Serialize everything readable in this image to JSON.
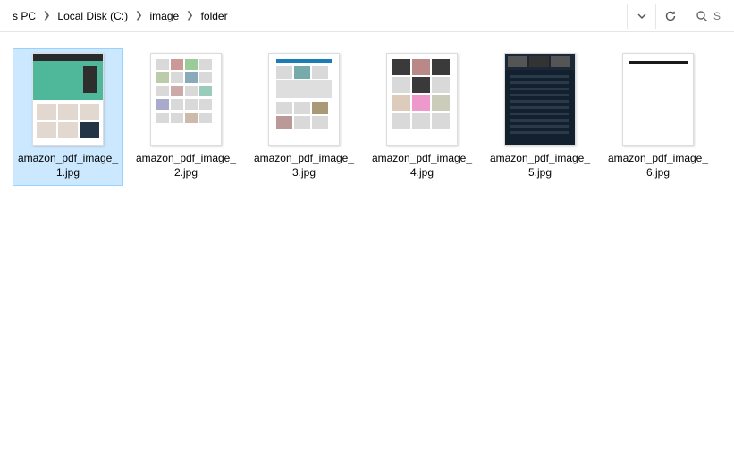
{
  "breadcrumb": {
    "items": [
      {
        "label": "s PC"
      },
      {
        "label": "Local Disk (C:)"
      },
      {
        "label": "image"
      },
      {
        "label": "folder"
      }
    ]
  },
  "toolbar": {
    "dropdown_name": "recent-locations-dropdown",
    "refresh_name": "refresh-button"
  },
  "search": {
    "placeholder": "S"
  },
  "files": [
    {
      "name": "amazon_pdf_image_1.jpg",
      "thumb": "t1",
      "selected": true
    },
    {
      "name": "amazon_pdf_image_2.jpg",
      "thumb": "t2",
      "selected": false
    },
    {
      "name": "amazon_pdf_image_3.jpg",
      "thumb": "t3",
      "selected": false
    },
    {
      "name": "amazon_pdf_image_4.jpg",
      "thumb": "t4",
      "selected": false
    },
    {
      "name": "amazon_pdf_image_5.jpg",
      "thumb": "t5",
      "selected": false
    },
    {
      "name": "amazon_pdf_image_6.jpg",
      "thumb": "t6",
      "selected": false
    }
  ]
}
